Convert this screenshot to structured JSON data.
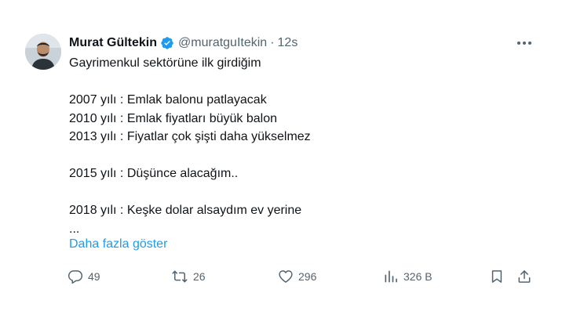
{
  "tweet": {
    "author": {
      "name": "Murat Gültekin",
      "handle": "@muratguItekin",
      "verified": true
    },
    "separator": "·",
    "time": "12s",
    "lines": [
      "Gayrimenkul sektörüne ilk girdiğim",
      "",
      "2007 yılı : Emlak balonu patlayacak",
      "2010 yılı : Emlak fiyatları büyük balon",
      "2013 yılı : Fiyatlar çok şişti daha yükselmez",
      "",
      "2015 yılı : Düşünce alacağım..",
      "",
      "2018 yılı : Keşke dolar alsaydım ev yerine",
      "..."
    ],
    "show_more": "Daha fazla göster",
    "actions": {
      "replies": "49",
      "retweets": "26",
      "likes": "296",
      "views": "326 B"
    }
  },
  "colors": {
    "accent": "#1d9bf0",
    "secondary_text": "#536471",
    "primary_text": "#0f1419"
  },
  "icons": [
    "more-icon",
    "verified-badge-icon",
    "reply-icon",
    "retweet-icon",
    "like-icon",
    "views-icon",
    "bookmark-icon",
    "share-icon"
  ]
}
